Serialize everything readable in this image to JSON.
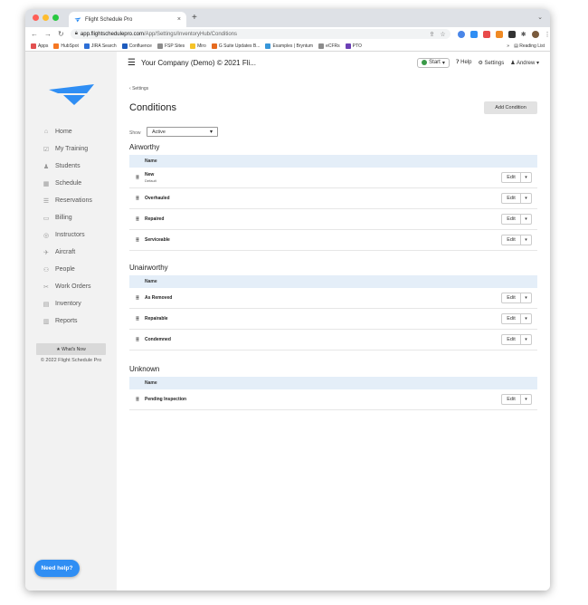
{
  "browser": {
    "tab_title": "Flight Schedule Pro",
    "tab_close": "×",
    "new_tab": "+",
    "tab_menu": "⌄",
    "url_host": "app.flightschedulepro.com",
    "url_path": "/App/Settings/InventoryHub/Conditions",
    "bookmarks": [
      {
        "label": "Apps",
        "color": "#e25050"
      },
      {
        "label": "HubSpot",
        "color": "#f57722"
      },
      {
        "label": "JIRA Search",
        "color": "#2d6fd6"
      },
      {
        "label": "Confluence",
        "color": "#1d5bbd"
      },
      {
        "label": "FSP Sites",
        "color": "#8c8c8c"
      },
      {
        "label": "Miro",
        "color": "#f6c327"
      },
      {
        "label": "G Suite Updates B...",
        "color": "#e66a1f"
      },
      {
        "label": "Examples | Bryntum",
        "color": "#3796d9"
      },
      {
        "label": "eCFRs",
        "color": "#8c8c8c"
      },
      {
        "label": "PTO",
        "color": "#6b3fb5"
      }
    ],
    "reading_list": "Reading List"
  },
  "sidebar": {
    "items": [
      {
        "label": "Home",
        "icon": "home-icon",
        "glyph": "⌂"
      },
      {
        "label": "My Training",
        "icon": "checkbox-icon",
        "glyph": "☑"
      },
      {
        "label": "Students",
        "icon": "student-icon",
        "glyph": "♟"
      },
      {
        "label": "Schedule",
        "icon": "calendar-icon",
        "glyph": "▦"
      },
      {
        "label": "Reservations",
        "icon": "list-icon",
        "glyph": "☰"
      },
      {
        "label": "Billing",
        "icon": "card-icon",
        "glyph": "▭"
      },
      {
        "label": "Instructors",
        "icon": "instructor-icon",
        "glyph": "◎"
      },
      {
        "label": "Aircraft",
        "icon": "plane-icon",
        "glyph": "✈"
      },
      {
        "label": "People",
        "icon": "people-icon",
        "glyph": "⚇"
      },
      {
        "label": "Work Orders",
        "icon": "wrench-icon",
        "glyph": "✂"
      },
      {
        "label": "Inventory",
        "icon": "inventory-icon",
        "glyph": "▤"
      },
      {
        "label": "Reports",
        "icon": "chart-icon",
        "glyph": "▥"
      }
    ],
    "whats_new": "★ What's Now",
    "copyright": "© 2022 Flight Schedule Pro",
    "need_help": "Need help?"
  },
  "header": {
    "company": "Your Company (Demo) © 2021 Fli...",
    "start": "Start",
    "help": "Help",
    "settings": "Settings",
    "user": "Andrew"
  },
  "page": {
    "back": "Settings",
    "title": "Conditions",
    "add_button": "Add Condition",
    "show_label": "Show",
    "show_value": "Active"
  },
  "sections": [
    {
      "title": "Airworthy",
      "column": "Name",
      "rows": [
        {
          "name": "New",
          "sub": "Default"
        },
        {
          "name": "Overhauled"
        },
        {
          "name": "Repaired"
        },
        {
          "name": "Serviceable"
        }
      ]
    },
    {
      "title": "Unairworthy",
      "column": "Name",
      "rows": [
        {
          "name": "As Removed"
        },
        {
          "name": "Repairable"
        },
        {
          "name": "Condemned"
        }
      ]
    },
    {
      "title": "Unknown",
      "column": "Name",
      "rows": [
        {
          "name": "Pending Inspection"
        }
      ]
    }
  ],
  "edit_label": "Edit",
  "colors": {
    "brand_blue": "#2f8ef4",
    "table_header_bg": "#e4eef8"
  }
}
